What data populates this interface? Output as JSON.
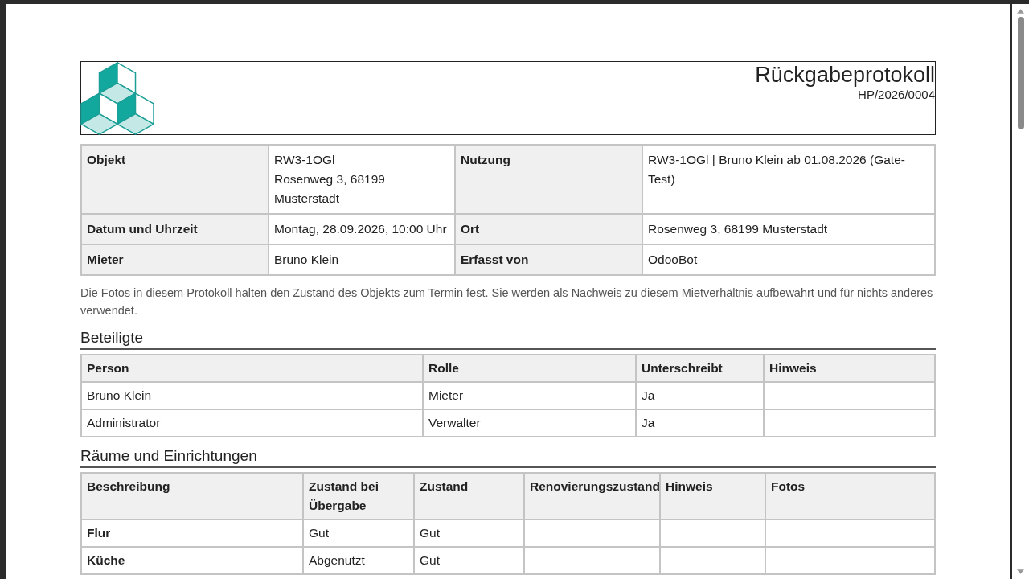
{
  "header": {
    "title": "Rückgabeprotokoll",
    "reference": "HP/2026/0004"
  },
  "info": [
    {
      "label": "Objekt",
      "value": [
        "RW3-1OGl",
        "Rosenweg 3, 68199 Musterstadt"
      ],
      "label2": "Nutzung",
      "value2": [
        "RW3-1OGl | Bruno Klein ab 01.08.2026 (Gate-Test)"
      ]
    },
    {
      "label": "Datum und Uhrzeit",
      "value": [
        "Montag, 28.09.2026, 10:00 Uhr"
      ],
      "label2": "Ort",
      "value2": [
        "Rosenweg 3, 68199 Musterstadt"
      ]
    },
    {
      "label": "Mieter",
      "value": [
        "Bruno Klein"
      ],
      "label2": "Erfasst von",
      "value2": [
        "OdooBot"
      ]
    }
  ],
  "note": "Die Fotos in diesem Protokoll halten den Zustand des Objekts zum Termin fest. Sie werden als Nachweis zu diesem Mietverhältnis aufbewahrt und für nichts anderes verwendet.",
  "participants": {
    "heading": "Beteiligte",
    "columns": [
      "Person",
      "Rolle",
      "Unterschreibt",
      "Hinweis"
    ],
    "rows": [
      {
        "person": "Bruno Klein",
        "role": "Mieter",
        "signs": "Ja"
      },
      {
        "person": "Administrator",
        "role": "Verwalter",
        "signs": "Ja"
      }
    ]
  },
  "rooms": {
    "heading": "Räume und Einrichtungen",
    "columns": [
      "Beschreibung",
      "Zustand bei Übergabe",
      "Zustand",
      "Renovierungszustand",
      "Hinweis",
      "Fotos"
    ],
    "rows": [
      {
        "description": "Flur",
        "handover_condition": "Gut",
        "condition": "Gut"
      },
      {
        "description": "Küche",
        "handover_condition": "Abgenutzt",
        "condition": "Gut"
      }
    ]
  }
}
